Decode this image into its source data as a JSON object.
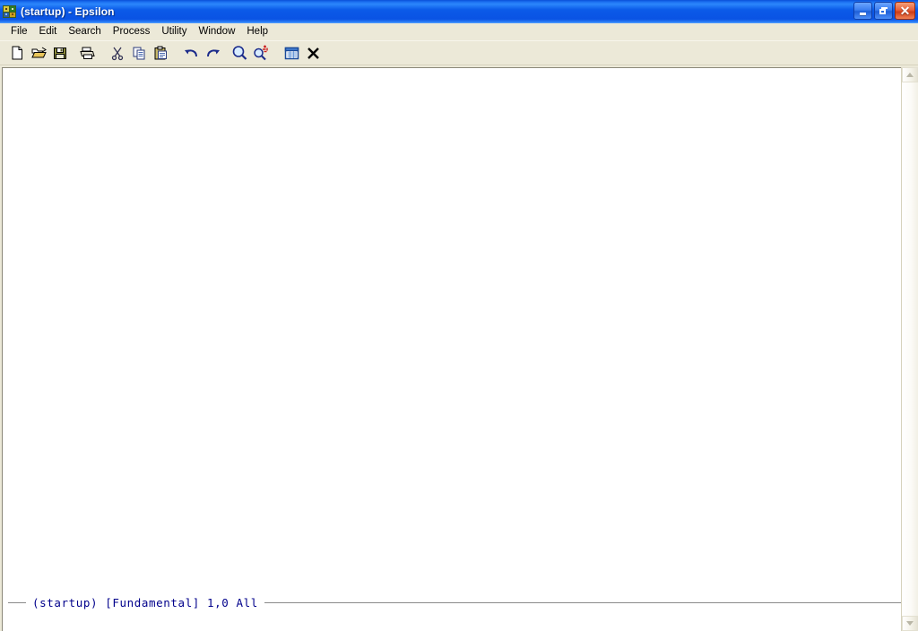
{
  "window": {
    "title": "(startup) - Epsilon",
    "icon": "epsilon-app-icon",
    "controls": {
      "minimize": "Minimize",
      "restore": "Restore",
      "close": "Close"
    }
  },
  "menu": {
    "items": [
      {
        "label": "File"
      },
      {
        "label": "Edit"
      },
      {
        "label": "Search"
      },
      {
        "label": "Process"
      },
      {
        "label": "Utility"
      },
      {
        "label": "Window"
      },
      {
        "label": "Help"
      }
    ]
  },
  "toolbar": {
    "buttons": [
      {
        "name": "new-file-icon",
        "title": "New"
      },
      {
        "name": "open-folder-icon",
        "title": "Open"
      },
      {
        "name": "save-floppy-icon",
        "title": "Save"
      },
      {
        "name": "print-icon",
        "title": "Print"
      },
      {
        "name": "cut-scissors-icon",
        "title": "Cut"
      },
      {
        "name": "copy-icon",
        "title": "Copy"
      },
      {
        "name": "paste-clipboard-icon",
        "title": "Paste"
      },
      {
        "name": "undo-arrow-icon",
        "title": "Undo"
      },
      {
        "name": "redo-arrow-icon",
        "title": "Redo"
      },
      {
        "name": "find-magnifier-icon",
        "title": "Find"
      },
      {
        "name": "replace-magnifier-icon",
        "title": "Replace"
      },
      {
        "name": "window-list-icon",
        "title": "Windows"
      },
      {
        "name": "close-x-icon",
        "title": "Close Window"
      }
    ]
  },
  "editor": {
    "buffer_text": "",
    "mode_line": {
      "buffer_name": "(startup)",
      "mode": "[Fundamental]",
      "position": "1,0",
      "scroll_state": "All",
      "full_text": "(startup)  [Fundamental]  1,0  All"
    }
  },
  "scrollbar": {
    "up_arrow": "scroll-up",
    "down_arrow": "scroll-down"
  },
  "colors": {
    "title_bar_blue": "#0a53e4",
    "chrome_beige": "#ECE9D8",
    "mode_line_text": "#00008B",
    "editor_background": "#FFFFFF"
  }
}
